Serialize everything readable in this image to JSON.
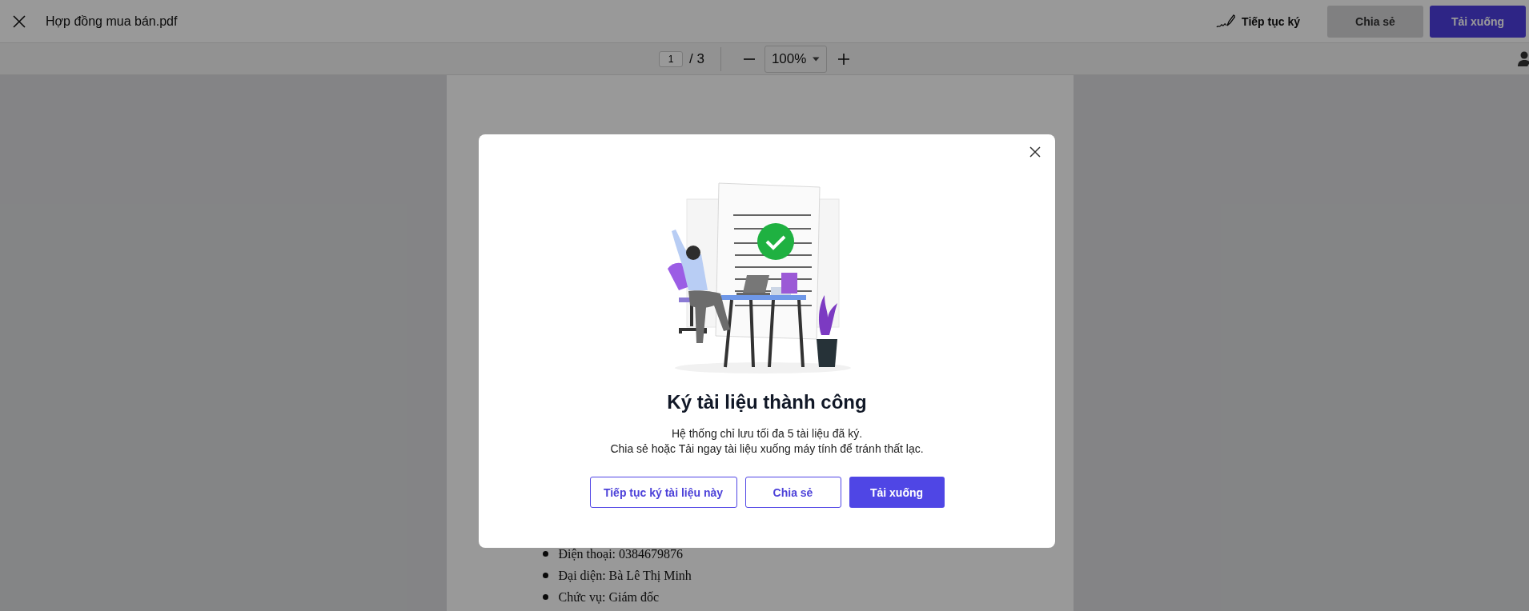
{
  "header": {
    "title": "Hợp đồng mua bán.pdf",
    "continue_sign": "Tiếp tục ký",
    "buttons": [
      {
        "label": "Chia sẻ",
        "kind": "secondary"
      },
      {
        "label": "Tải xuống",
        "kind": "primary"
      }
    ]
  },
  "toolbar": {
    "page": "1",
    "page_total": "/ 3",
    "zoom": "100%"
  },
  "document": {
    "bullets": [
      "Điện thoại: 0384679876",
      "Đại diện: Bà Lê Thị Minh",
      "Chức vụ: Giám đốc"
    ]
  },
  "dialog": {
    "title": "Ký tài liệu thành công",
    "message": [
      "Hệ thống chỉ lưu tối đa 5 tài liệu đã ký.",
      "Chia sẻ hoặc Tải ngay tài liệu xuống máy tính để tránh thất lạc."
    ],
    "buttons": [
      {
        "label": "Tiếp tục ký tài liệu này",
        "kind": "outline"
      },
      {
        "label": "Chia sẻ",
        "kind": "outline"
      },
      {
        "label": "Tải xuống",
        "kind": "primary"
      }
    ]
  }
}
